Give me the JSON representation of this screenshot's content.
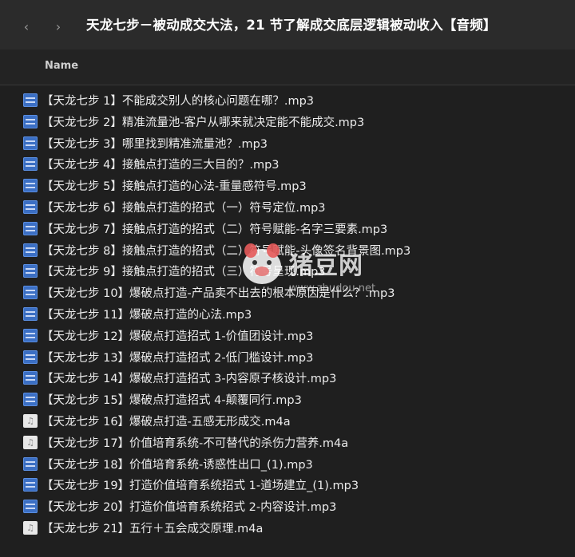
{
  "toolbar": {
    "title": "天龙七步－被动成交大法，21 节了解成交底层逻辑被动收入【音频】",
    "back_glyph": "‹",
    "forward_glyph": "›"
  },
  "columns": {
    "name_label": "Name"
  },
  "files": [
    {
      "name": "【天龙七步 1】不能成交别人的核心问题在哪？.mp3",
      "icon": "mp3-audio-file-icon"
    },
    {
      "name": "【天龙七步 2】精准流量池-客户从哪来就决定能不能成交.mp3",
      "icon": "mp3-audio-file-icon"
    },
    {
      "name": "【天龙七步 3】哪里找到精准流量池？.mp3",
      "icon": "mp3-audio-file-icon"
    },
    {
      "name": "【天龙七步 4】接触点打造的三大目的？.mp3",
      "icon": "mp3-audio-file-icon"
    },
    {
      "name": "【天龙七步 5】接触点打造的心法-重量感符号.mp3",
      "icon": "mp3-audio-file-icon"
    },
    {
      "name": "【天龙七步 6】接触点打造的招式（一）符号定位.mp3",
      "icon": "mp3-audio-file-icon"
    },
    {
      "name": "【天龙七步 7】接触点打造的招式（二）符号赋能-名字三要素.mp3",
      "icon": "mp3-audio-file-icon"
    },
    {
      "name": "【天龙七步 8】接触点打造的招式（二）符号赋能-头像签名背景图.mp3",
      "icon": "mp3-audio-file-icon"
    },
    {
      "name": "【天龙七步 9】接触点打造的招式（三）符号呈现.mp3",
      "icon": "mp3-audio-file-icon"
    },
    {
      "name": "【天龙七步 10】爆破点打造-产品卖不出去的根本原因是什么？.mp3",
      "icon": "mp3-audio-file-icon"
    },
    {
      "name": "【天龙七步 11】爆破点打造的心法.mp3",
      "icon": "mp3-audio-file-icon"
    },
    {
      "name": "【天龙七步 12】爆破点打造招式 1-价值团设计.mp3",
      "icon": "mp3-audio-file-icon"
    },
    {
      "name": "【天龙七步 13】爆破点打造招式 2-低门槛设计.mp3",
      "icon": "mp3-audio-file-icon"
    },
    {
      "name": "【天龙七步 14】爆破点打造招式 3-内容原子核设计.mp3",
      "icon": "mp3-audio-file-icon"
    },
    {
      "name": "【天龙七步 15】爆破点打造招式 4-颠覆同行.mp3",
      "icon": "mp3-audio-file-icon"
    },
    {
      "name": "【天龙七步 16】爆破点打造-五感无形成交.m4a",
      "icon": "m4a-audio-file-icon"
    },
    {
      "name": "【天龙七步 17】价值培育系统-不可替代的杀伤力营养.m4a",
      "icon": "m4a-audio-file-icon"
    },
    {
      "name": "【天龙七步 18】价值培育系统-诱惑性出口_(1).mp3",
      "icon": "mp3-audio-file-icon"
    },
    {
      "name": "【天龙七步 19】打造价值培育系统招式 1-道场建立_(1).mp3",
      "icon": "mp3-audio-file-icon"
    },
    {
      "name": "【天龙七步 20】打造价值培育系统招式 2-内容设计.mp3",
      "icon": "mp3-audio-file-icon"
    },
    {
      "name": "【天龙七步 21】五行＋五会成交原理.m4a",
      "icon": "m4a-audio-file-icon"
    }
  ],
  "watermark": {
    "text": "猪豆网",
    "url": "www.zhudou.net"
  },
  "colors": {
    "background": "#1f1f1f",
    "toolbar": "#2b2b2b",
    "mp3_icon": "#3b6fc4",
    "m4a_icon": "#e8e8e8",
    "text": "#ececec"
  }
}
